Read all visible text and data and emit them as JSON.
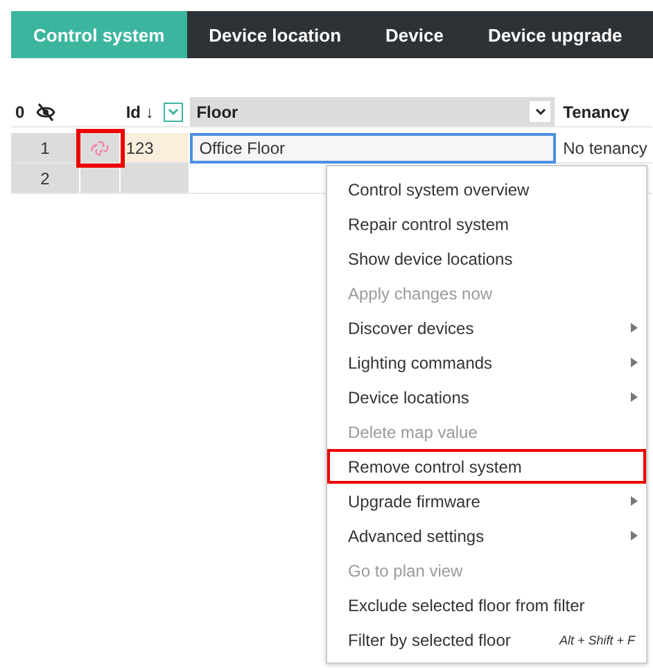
{
  "tabs": [
    {
      "label": "Control system",
      "selected": true
    },
    {
      "label": "Device location",
      "selected": false
    },
    {
      "label": "Device",
      "selected": false
    },
    {
      "label": "Device upgrade",
      "selected": false
    }
  ],
  "grid": {
    "row_count_header": "0",
    "columns": [
      {
        "kind": "icon"
      },
      {
        "kind": "id",
        "label": "Id ↓"
      },
      {
        "kind": "floor",
        "label": "Floor"
      },
      {
        "kind": "text",
        "label": "Tenancy"
      }
    ],
    "rows": [
      {
        "number": "1",
        "icon_outlined": true,
        "id": "123",
        "floor": "Office Floor",
        "tenancy": "No tenancy",
        "editing": true
      },
      {
        "number": "2",
        "icon_outlined": false,
        "editing": false
      }
    ]
  },
  "context_menu": [
    {
      "label": "Control system overview",
      "disabled": false,
      "submenu": false,
      "outlined": false
    },
    {
      "label": "Repair control system",
      "disabled": false,
      "submenu": false,
      "outlined": false
    },
    {
      "label": "Show device locations",
      "disabled": false,
      "submenu": false,
      "outlined": false
    },
    {
      "label": "Apply changes now",
      "disabled": true,
      "submenu": false,
      "outlined": false
    },
    {
      "label": "Discover devices",
      "disabled": false,
      "submenu": true,
      "outlined": false
    },
    {
      "label": "Lighting commands",
      "disabled": false,
      "submenu": true,
      "outlined": false
    },
    {
      "label": "Device locations",
      "disabled": false,
      "submenu": true,
      "outlined": false
    },
    {
      "label": "Delete map value",
      "disabled": true,
      "submenu": false,
      "outlined": false
    },
    {
      "label": "Remove control system",
      "disabled": false,
      "submenu": false,
      "outlined": true
    },
    {
      "label": "Upgrade firmware",
      "disabled": false,
      "submenu": true,
      "outlined": false
    },
    {
      "label": "Advanced settings",
      "disabled": false,
      "submenu": true,
      "outlined": false
    },
    {
      "label": "Go to plan view",
      "disabled": true,
      "submenu": false,
      "outlined": false
    },
    {
      "label": "Exclude selected floor from filter",
      "disabled": false,
      "submenu": false,
      "outlined": false
    },
    {
      "label": "Filter by selected floor",
      "disabled": false,
      "submenu": false,
      "outlined": false,
      "shortcut": "Alt + Shift + F"
    }
  ]
}
